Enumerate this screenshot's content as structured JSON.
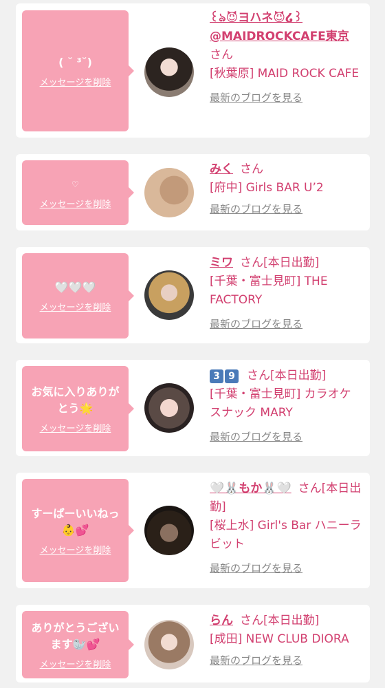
{
  "items": [
    {
      "message": "( ˘ ³˘)",
      "delete_label": "メッセージを削除",
      "name": "꒰ঌ😈ヨハネ😈໒꒱ @MAIDROCKCAFE東京",
      "san": "さん",
      "shop": "[秋葉原] MAID ROCK CAFE",
      "blog_label": "最新のブログを見る"
    },
    {
      "message": "♡",
      "delete_label": "メッセージを削除",
      "name": "みく",
      "san": "さん",
      "shop": "[府中] Girls BAR U’2",
      "blog_label": "最新のブログを見る"
    },
    {
      "message": "🤍🤍🤍",
      "delete_label": "メッセージを削除",
      "name": "ミワ",
      "san": "さん[本日出勤]",
      "shop": "[千葉・富士見町] THE FACTORY",
      "blog_label": "最新のブログを見る"
    },
    {
      "message": "お気に入りありがとう🌟",
      "delete_label": "メッセージを削除",
      "name": "3 9",
      "san": "さん[本日出勤]",
      "shop": "[千葉・富士見町] カラオケスナック MARY",
      "blog_label": "最新のブログを見る"
    },
    {
      "message": "すーぱーいいねっ👶💕",
      "delete_label": "メッセージを削除",
      "name": "🤍🐰もか🐰🤍",
      "san": "さん[本日出勤]",
      "shop": "[桜上水] Girl's Bar ハニーラビット",
      "blog_label": "最新のブログを見る"
    },
    {
      "message": "ありがとうございます🦭💕",
      "delete_label": "メッセージを削除",
      "name": "らん",
      "san": "さん[本日出勤]",
      "shop": "[成田] NEW CLUB DIORA",
      "blog_label": "最新のブログを見る"
    }
  ]
}
